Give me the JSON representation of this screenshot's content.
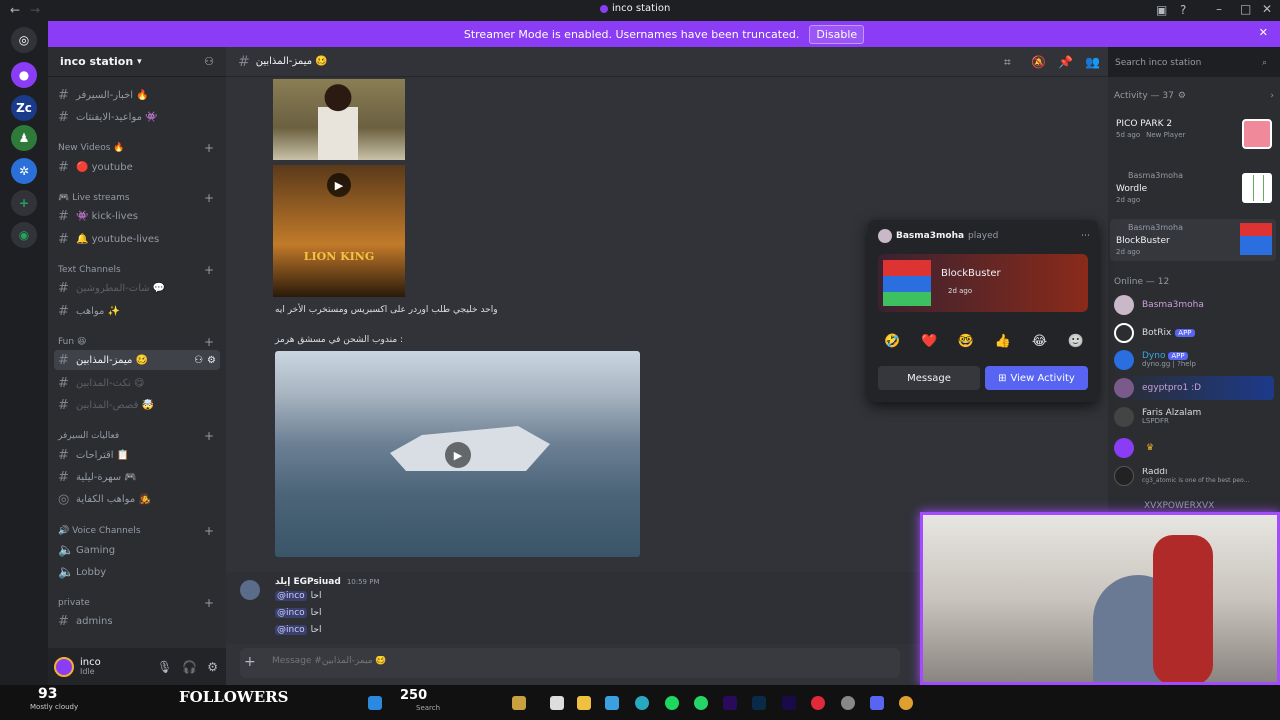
{
  "window": {
    "title": "inco station"
  },
  "banner": {
    "text": "Streamer Mode is enabled. Usernames have been truncated.",
    "disable_label": "Disable"
  },
  "server": {
    "name": "inco station"
  },
  "channels": [
    {
      "label": "اخبار-السيرفر 🔥"
    },
    {
      "label": "مواعيد-الايفنتات 👾"
    },
    {
      "label": "🔴 youtube"
    },
    {
      "label": "👾 kick-lives"
    },
    {
      "label": "🔔 youtube-lives"
    },
    {
      "label": "شات-المطروشين 💬"
    },
    {
      "label": "مواهب ✨"
    },
    {
      "label": "ميمز-المذابين 🥴"
    },
    {
      "label": "نكت-المذابين 😋"
    },
    {
      "label": "قصص-المذابين 🤯"
    },
    {
      "label": "اقتراحات 📋"
    },
    {
      "label": "سهرة-ليلية 🎮"
    },
    {
      "label": "مواهب الكفاية 🧑‍🎤"
    },
    {
      "label": "Gaming"
    },
    {
      "label": "Lobby"
    },
    {
      "label": "admins"
    }
  ],
  "categories": {
    "new_videos": "New Videos 🔥",
    "live_streams": "🎮 Live streams",
    "text_channels": "Text Channels",
    "fun": "Fun 😆",
    "events": "فعاليات السيرفر",
    "voice": "🔊 Voice Channels",
    "private": "private"
  },
  "channel_header": {
    "name": "ميمز-المذابين 🥴"
  },
  "search": {
    "placeholder": "Search inco station"
  },
  "messages": {
    "caption1": "واحد خليجي طلب اوردر على اكسبريس ومستخرب الأخر ايه",
    "caption2": "مندوب الشحن في مسشق هرمز :",
    "video_title": "LION KING",
    "author": "إيلد EGPsiuad",
    "time": "10:59 PM",
    "mention": "@inco",
    "reply": "احا"
  },
  "composer": {
    "placeholder": "Message #ميمز-المذابين 🥴"
  },
  "user": {
    "name": "inco",
    "status": "Idle"
  },
  "activity": {
    "header": "Activity — 37",
    "items": [
      {
        "user": "",
        "game": "PICO PARK 2",
        "meta": "5d ago",
        "badge": "New Player"
      },
      {
        "user": "Basma3moha",
        "game": "Wordle",
        "meta": "2d ago",
        "badge": ""
      },
      {
        "user": "Basma3moha",
        "game": "BlockBuster",
        "meta": "2d ago",
        "badge": ""
      }
    ]
  },
  "online": {
    "header": "Online — 12",
    "members": [
      {
        "name": "Basma3moha",
        "sub": "",
        "tag": ""
      },
      {
        "name": "BotRix",
        "sub": "",
        "tag": "APP"
      },
      {
        "name": "Dyno",
        "sub": "dyno.gg | ?help",
        "tag": "APP"
      },
      {
        "name": "egyptpro1 :D",
        "sub": "",
        "tag": ""
      },
      {
        "name": "Faris Alzalam",
        "sub": "LSPDFR",
        "tag": ""
      },
      {
        "name": "",
        "sub": "",
        "tag": ""
      },
      {
        "name": "Raddi",
        "sub": "cg3_atomic is one of the best peo...",
        "tag": ""
      },
      {
        "name": "XVXPOWERXVX",
        "sub": "",
        "tag": ""
      }
    ]
  },
  "popup": {
    "user": "Basma3moha",
    "verb": "played",
    "game": "BlockBuster",
    "meta": "2d ago",
    "reactions": [
      "🤣",
      "❤️",
      "🤓",
      "👍",
      "😂",
      "🙂"
    ],
    "message_btn": "Message",
    "view_btn": "View Activity"
  },
  "stream": {
    "followers_count": "93",
    "followers_label": "FOLLOWERS",
    "viewers": "250",
    "weather": "Mostly cloudy",
    "taskbar_search": "Search"
  },
  "colors": {
    "accent": "#5865f2",
    "banner": "#8b3cf5",
    "app_badge": "#5865f2"
  }
}
